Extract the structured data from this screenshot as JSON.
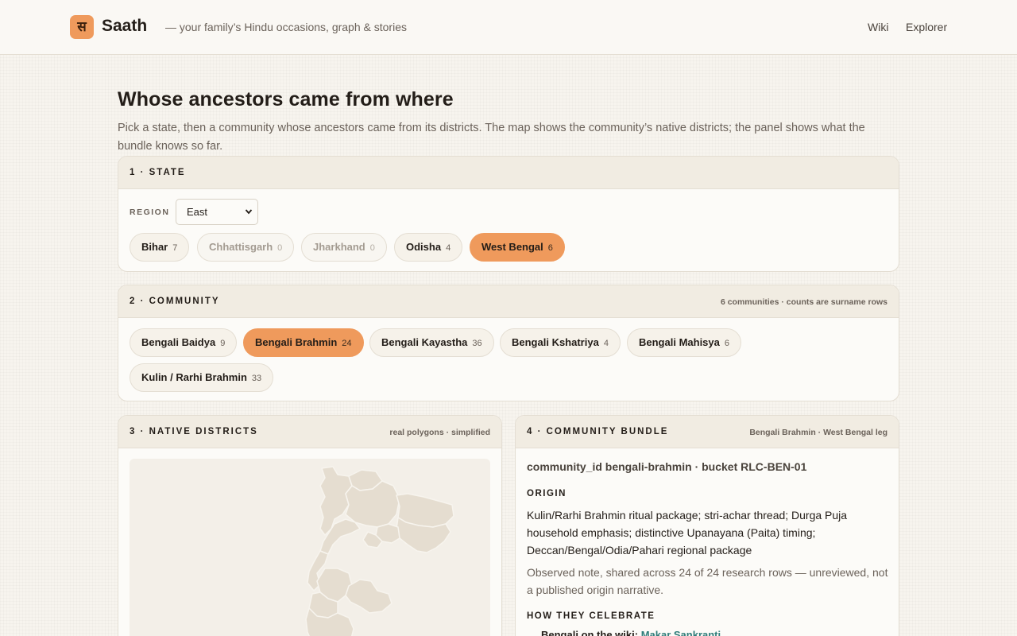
{
  "header": {
    "logo_glyph": "स",
    "brand": "Saath",
    "tagline": "— your family’s Hindu occasions, graph & stories",
    "nav": [
      "Wiki",
      "Explorer"
    ]
  },
  "page": {
    "title": "Whose ancestors came from where",
    "description": "Pick a state, then a community whose ancestors came from its districts. The map shows the community’s native districts; the panel shows what the bundle knows so far."
  },
  "state_card": {
    "title": "1 · STATE",
    "region_label": "REGION",
    "region_value": "East",
    "states": [
      {
        "name": "Bihar",
        "count": "7",
        "state": "normal"
      },
      {
        "name": "Chhattisgarh",
        "count": "0",
        "state": "disabled"
      },
      {
        "name": "Jharkhand",
        "count": "0",
        "state": "disabled"
      },
      {
        "name": "Odisha",
        "count": "4",
        "state": "normal"
      },
      {
        "name": "West Bengal",
        "count": "6",
        "state": "active"
      }
    ]
  },
  "community_card": {
    "title": "2 · COMMUNITY",
    "note": "6 communities · counts are surname rows",
    "communities": [
      {
        "name": "Bengali Baidya",
        "count": "9",
        "state": "normal"
      },
      {
        "name": "Bengali Brahmin",
        "count": "24",
        "state": "active"
      },
      {
        "name": "Bengali Kayastha",
        "count": "36",
        "state": "normal"
      },
      {
        "name": "Bengali Kshatriya",
        "count": "4",
        "state": "normal"
      },
      {
        "name": "Bengali Mahisya",
        "count": "6",
        "state": "normal"
      },
      {
        "name": "Kulin / Rarhi Brahmin",
        "count": "33",
        "state": "normal"
      }
    ]
  },
  "districts_card": {
    "title": "3 · NATIVE DISTRICTS",
    "note": "real polygons · simplified",
    "map_fill": "#e5ddd0",
    "map_stroke": "#f7f4ee"
  },
  "bundle_card": {
    "title": "4 · COMMUNITY BUNDLE",
    "note": "Bengali Brahmin · West Bengal leg",
    "id_line": "community_id bengali-brahmin · bucket RLC-BEN-01",
    "origin_heading": "ORIGIN",
    "origin_text": "Kulin/Rarhi Brahmin ritual package; stri-achar thread; Durga Puja household emphasis; distinctive Upanayana (Paita) timing; Deccan/Bengal/Odia/Pahari regional package",
    "origin_note": "Observed note, shared across 24 of 24 research rows — unreviewed, not a published origin narrative.",
    "celebrate_heading": "HOW THEY CELEBRATE",
    "celebrate_prefix": "Bengali on the wiki: ",
    "celebrate_link": "Makar Sankranti"
  },
  "colors": {
    "accent": "#ef9a5c",
    "link": "#2f7d7a",
    "background": "#f7f4ee"
  }
}
